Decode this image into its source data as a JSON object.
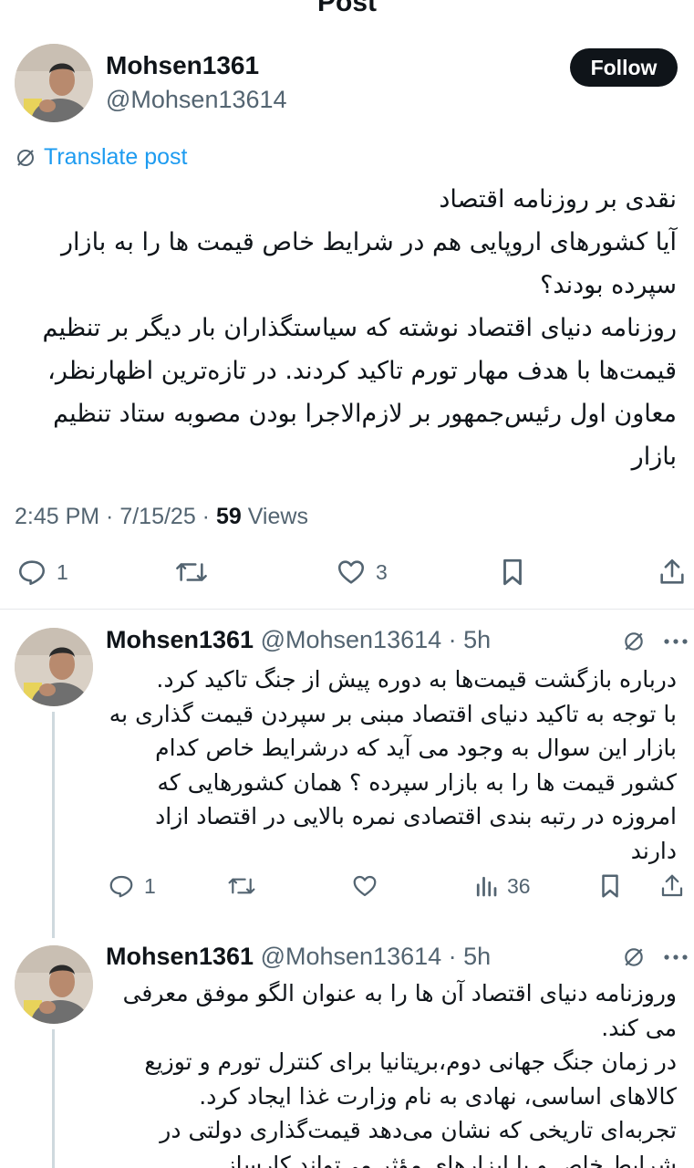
{
  "header": {
    "title": "Post"
  },
  "main_post": {
    "name": "Mohsen1361",
    "handle": "@Mohsen13614",
    "follow_label": "Follow",
    "translate_label": "Translate post",
    "text": "نقدی بر روزنامه اقتصاد\nآیا کشورهای اروپایی هم در شرایط خاص قیمت ها را به بازار سپرده بودند؟\nروزنامه دنیای اقتصاد نوشته که سیاستگذاران بار دیگر بر تنظیم قیمت‌ها با هدف مهار تورم تاکید کردند. در تازه‌ترین اظهارنظر، معاون اول رئیس‌جمهور بر لازم‌الاجرا بودن مصوبه ستاد تنظیم بازار",
    "time": "2:45 PM · 7/15/25 · ",
    "views_count": "59",
    "views_label": " Views",
    "reply_count": "1",
    "like_count": "3"
  },
  "replies": [
    {
      "name": "Mohsen1361",
      "handle": "@Mohsen13614 · 5h",
      "text": "درباره بازگشت قیمت‌ها به دوره پیش از جنگ تاکید کرد.\nبا توجه به تاکید دنیای اقتصاد مبنی بر سپردن قیمت گذاری به بازار این سوال به وجود می آید که درشرایط خاص کدام کشور قیمت ها را به بازار سپرده ؟ همان کشورهایی که امروزه در رتبه بندی اقتصادی نمره بالایی در اقتصاد ازاد دارند",
      "reply_count": "1",
      "views_count": "36"
    },
    {
      "name": "Mohsen1361",
      "handle": "@Mohsen13614 · 5h",
      "text": "وروزنامه دنیای اقتصاد آن ها را به عنوان الگو موفق معرفی می کند.\nدر زمان جنگ جهانی دوم،بریتانیا برای کنترل تورم و توزیع کالاهای اساسی، نهادی به نام وزارت غذا ایجاد کرد.\nتجربه‌ای تاریخی که نشان می‌دهد قیمت‌گذاری دولتی در شرایط خاص و با ابزارهای مؤثر می‌تواند کارساز"
    }
  ]
}
